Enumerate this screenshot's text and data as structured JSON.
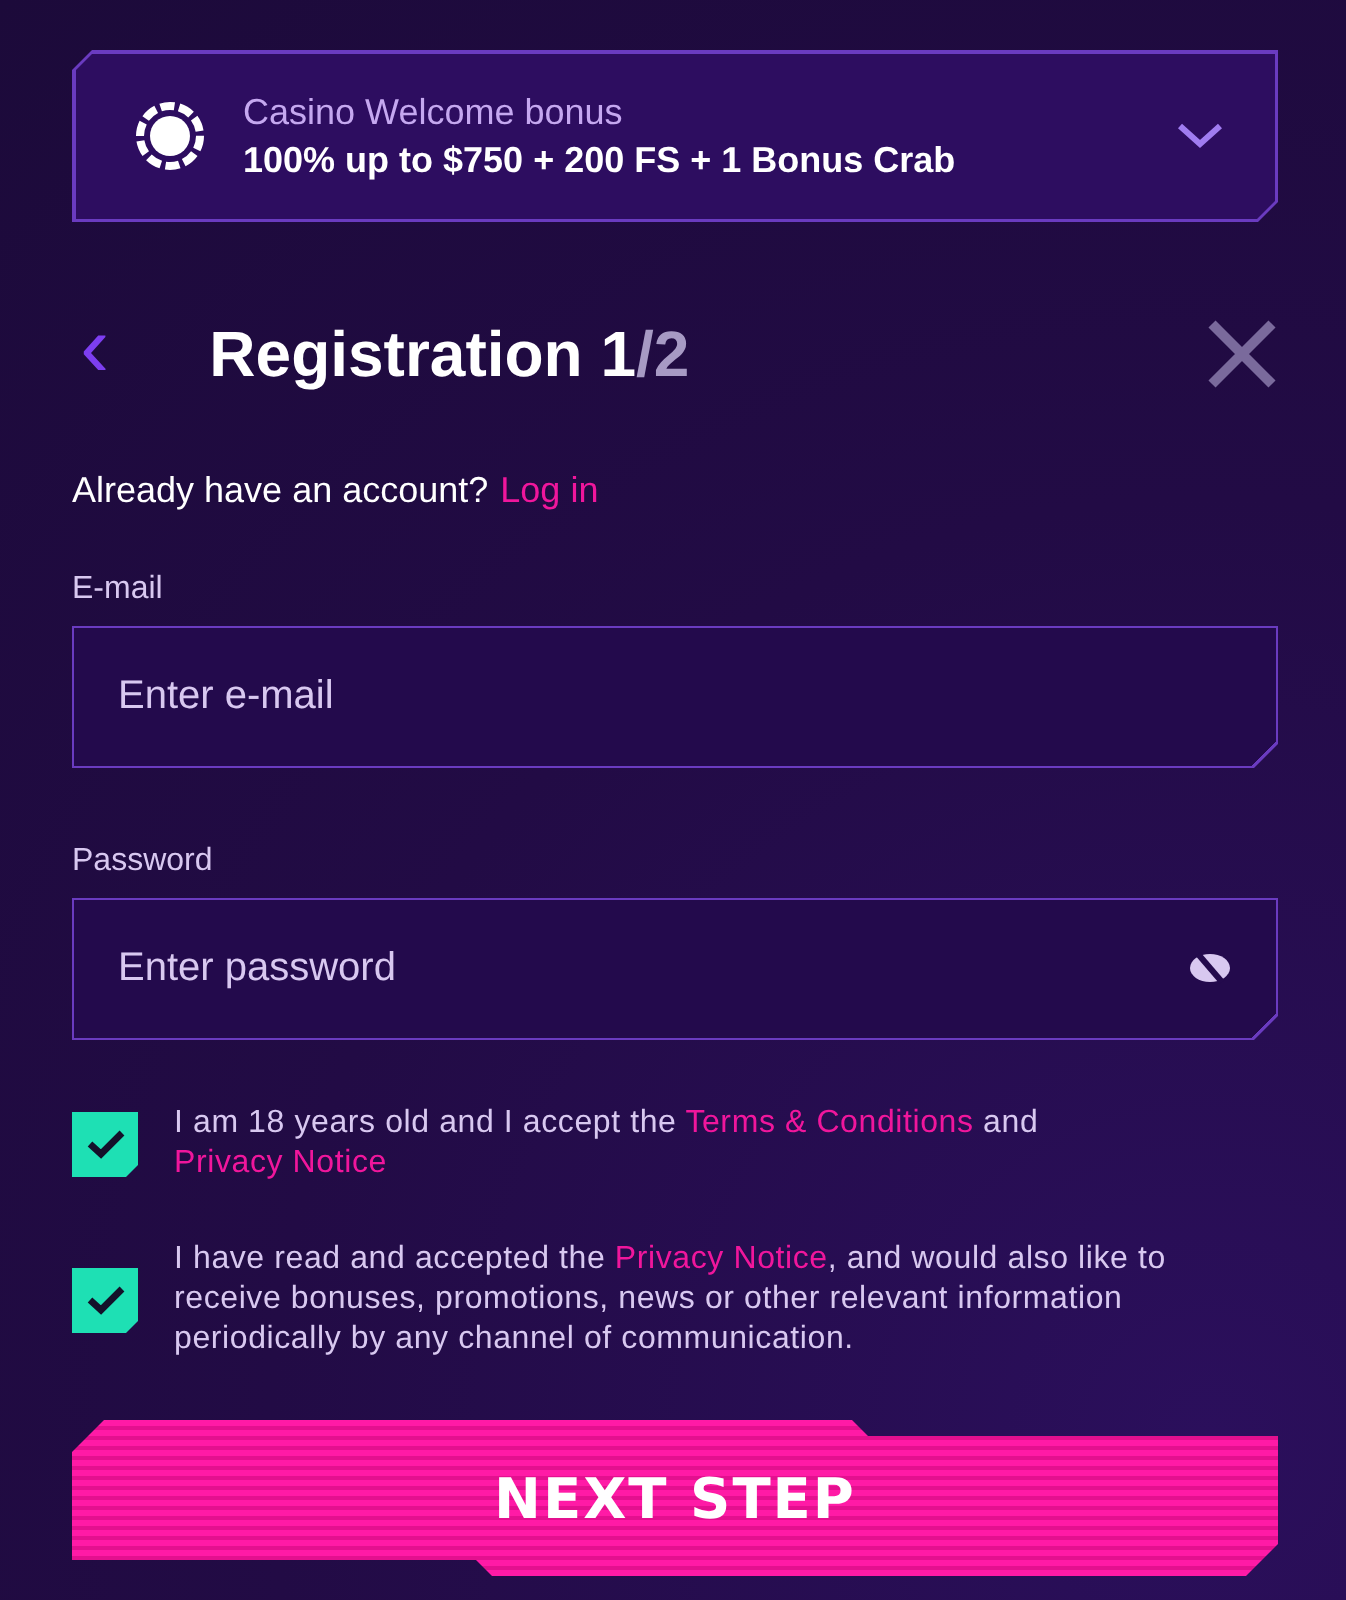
{
  "bonus": {
    "title": "Casino Welcome bonus",
    "offer": "100% up to $750 + 200 FS + 1 Bonus Crab",
    "expanded": false
  },
  "header": {
    "back": "‹",
    "title_parts": [
      {
        "text": "Registration 1",
        "dim": false
      },
      {
        "text": "/2",
        "dim": true
      }
    ]
  },
  "login_prompt": {
    "text": "Already have an account?",
    "link": "Log in"
  },
  "fields": [
    {
      "label": "E-mail",
      "placeholder": "Enter e-mail",
      "kind": "text"
    },
    {
      "label": "Password",
      "placeholder": "Enter password",
      "kind": "password"
    }
  ],
  "consents": [
    {
      "checked": true,
      "parts": [
        {
          "text": "I am 18 years old and I accept the ",
          "link": false
        },
        {
          "text": "Terms & Conditions",
          "link": true
        },
        {
          "text": " and ",
          "link": false
        },
        {
          "text": "Privacy Notice",
          "link": true
        }
      ]
    },
    {
      "checked": true,
      "parts": [
        {
          "text": "I have read and accepted the ",
          "link": false
        },
        {
          "text": "Privacy Notice",
          "link": true
        },
        {
          "text": ", and would also like to receive bonuses, promotions, news or other relevant information periodically by any channel of communication.",
          "link": false
        }
      ]
    }
  ],
  "submit": "NEXT STEP"
}
